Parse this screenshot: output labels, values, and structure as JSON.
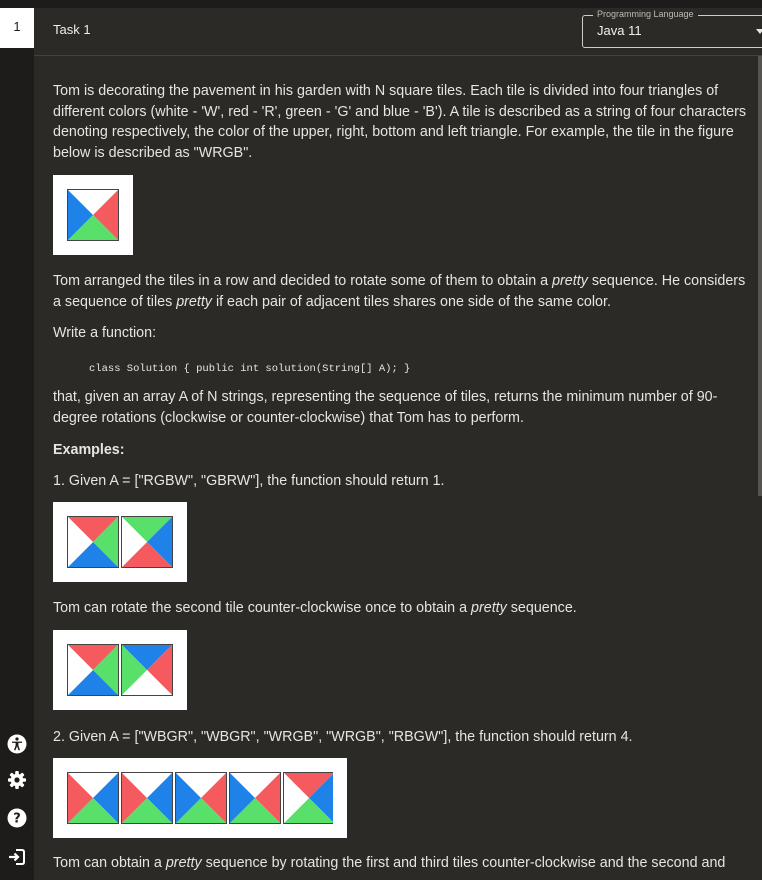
{
  "sidebar": {
    "task_number": "1",
    "icons": [
      "accessibility-icon",
      "gear-icon",
      "help-icon",
      "logout-icon"
    ]
  },
  "header": {
    "task_title": "Task 1",
    "language_label": "Programming Language",
    "language_value": "Java 11"
  },
  "colors": {
    "W": "#ffffff",
    "R": "#f55a5f",
    "G": "#58e06a",
    "B": "#1e82e9",
    "border": "#444444"
  },
  "problem": {
    "intro": "Tom is decorating the pavement in his garden with N square tiles. Each tile is divided into four triangles of different colors (white - 'W', red - 'R', green - 'G' and blue - 'B'). A tile is described as a string of four characters denoting respectively, the color of the upper, right, bottom and left triangle. For example, the tile in the figure below is described as \"WRGB\".",
    "figure_tiles": [
      "WRGB"
    ],
    "arranged_pre": "Tom arranged the tiles in a row and decided to rotate some of them to obtain a ",
    "arranged_em": "pretty",
    "arranged_mid": " sequence. He considers a sequence of tiles ",
    "arranged_em2": "pretty",
    "arranged_post": " if each pair of adjacent tiles shares one side of the same color.",
    "write_fn": "Write a function:",
    "signature": "class Solution { public int solution(String[] A); }",
    "returns": "that, given an array A of N strings, representing the sequence of tiles, returns the minimum number of 90-degree rotations (clockwise or counter-clockwise) that Tom has to perform.",
    "examples_heading": "Examples:",
    "ex1_text": "1. Given A = [\"RGBW\", \"GBRW\"], the function should return 1.",
    "ex1_tiles": [
      "RGBW",
      "GBRW"
    ],
    "ex1_expl_pre": "Tom can rotate the second tile counter-clockwise once to obtain a ",
    "ex1_expl_em": "pretty",
    "ex1_expl_post": " sequence.",
    "ex1_result_tiles": [
      "RGBW",
      "BRWG"
    ],
    "ex2_text": "2. Given A = [\"WBGR\", \"WBGR\", \"WRGB\", \"WRGB\", \"RBGW\"], the function should return 4.",
    "ex2_tiles": [
      "WBGR",
      "WBGR",
      "WRGB",
      "WRGB",
      "RBGW"
    ],
    "ex2_expl_pre": "Tom can obtain a ",
    "ex2_expl_em": "pretty",
    "ex2_expl_post": " sequence by rotating the first and third tiles counter-clockwise and the second and"
  }
}
